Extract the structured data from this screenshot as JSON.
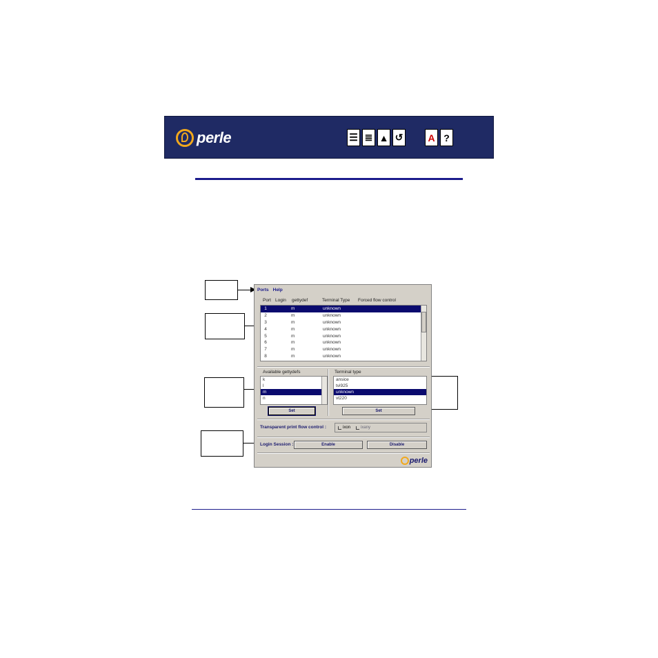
{
  "header": {
    "logo_text": "perle",
    "brand_color": "#1f2a64",
    "accent_color": "#f2a81c",
    "nav_icons": [
      "contents-icon",
      "index-icon",
      "top-icon",
      "back-icon"
    ],
    "nav_icons2": [
      "text-icon",
      "help-icon"
    ]
  },
  "window": {
    "menus": [
      "Ports",
      "Help"
    ],
    "columns": [
      "Port",
      "Login",
      "gettydef",
      "Terminal Type",
      "Forced flow control"
    ],
    "ports": [
      {
        "port": "1",
        "login": "",
        "getty": "m",
        "term": "unknown",
        "selected": true
      },
      {
        "port": "2",
        "login": "",
        "getty": "m",
        "term": "unknown"
      },
      {
        "port": "3",
        "login": "",
        "getty": "m",
        "term": "unknown"
      },
      {
        "port": "4",
        "login": "",
        "getty": "m",
        "term": "unknown"
      },
      {
        "port": "5",
        "login": "",
        "getty": "m",
        "term": "unknown"
      },
      {
        "port": "6",
        "login": "",
        "getty": "m",
        "term": "unknown"
      },
      {
        "port": "7",
        "login": "",
        "getty": "m",
        "term": "unknown"
      },
      {
        "port": "8",
        "login": "",
        "getty": "m",
        "term": "unknown"
      }
    ],
    "gettydefs_label": "Available gettydefs",
    "gettydefs": [
      {
        "text": "k",
        "selected": false
      },
      {
        "text": "l",
        "selected": false
      },
      {
        "text": "m",
        "selected": true
      },
      {
        "text": "n",
        "selected": false
      }
    ],
    "terminal_label": "Terminal type",
    "terminals": [
      {
        "text": "ansice",
        "selected": false
      },
      {
        "text": "tvi925",
        "selected": false
      },
      {
        "text": "unknown",
        "selected": true
      },
      {
        "text": "vt220",
        "selected": false
      }
    ],
    "set_label": "Set",
    "set_label2": "Set",
    "flow_label": "Transparent print flow control :",
    "flow_options": [
      "ixon",
      "ixany"
    ],
    "login_label": "Login Session :",
    "enable_label": "Enable",
    "disable_label": "Disable",
    "logo_text": "perle"
  }
}
